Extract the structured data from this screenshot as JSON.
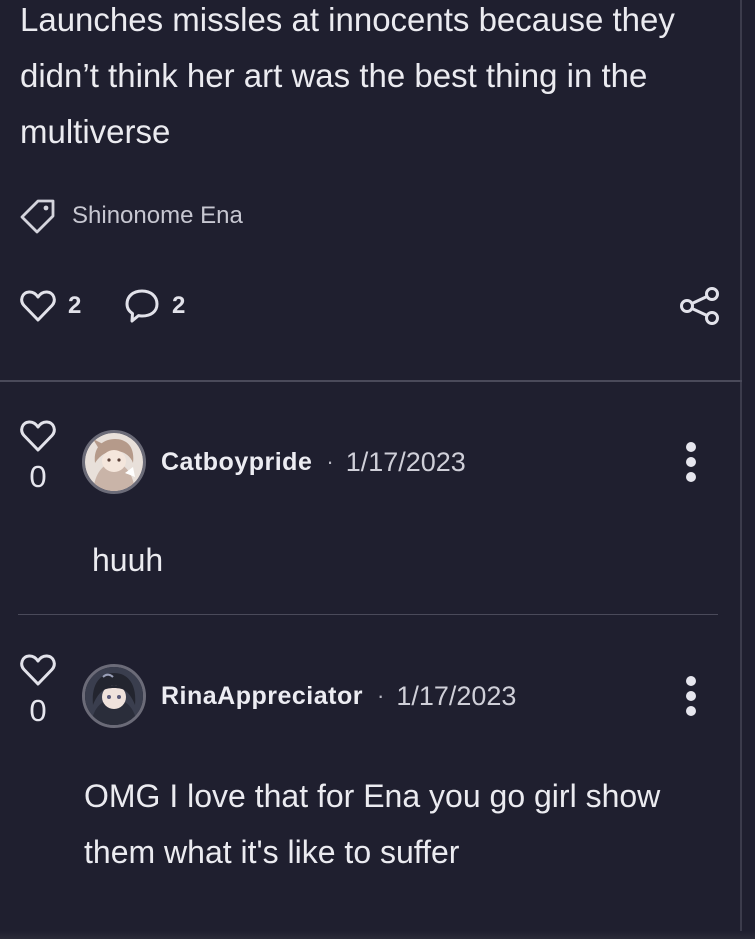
{
  "post": {
    "body": "Launches missles at innocents because they didn’t think her art was the best thing in the multiverse",
    "tag": {
      "label": "Shinonome Ena",
      "icon": "tag-icon"
    },
    "actions": {
      "like_count": "2",
      "comment_count": "2",
      "like_icon": "heart-icon",
      "comment_icon": "speech-bubble-icon",
      "share_icon": "share-icon"
    }
  },
  "comments": [
    {
      "votes": "0",
      "username": "Catboypride",
      "separator": "·",
      "date": "1/17/2023",
      "text": "huuh",
      "avatar_icon": "avatar-image",
      "more_icon": "vertical-dots-icon"
    },
    {
      "votes": "0",
      "username": "RinaAppreciator",
      "separator": "·",
      "date": "1/17/2023",
      "text": "OMG I love that for Ena you go girl show them what it's like to suffer",
      "avatar_icon": "avatar-image",
      "more_icon": "vertical-dots-icon"
    }
  ],
  "colors": {
    "background": "#1f1f2f",
    "text": "#ebebf0",
    "muted": "#c7c7d1",
    "divider": "#4a4a5a"
  }
}
